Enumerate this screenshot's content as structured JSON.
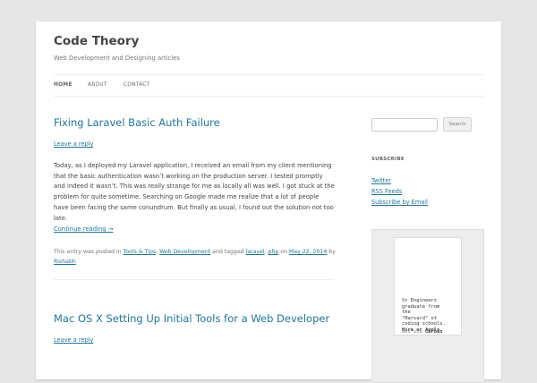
{
  "site": {
    "title": "Code Theory",
    "description": "Web Development and Designing articles"
  },
  "nav": {
    "items": [
      {
        "label": "HOME",
        "active": true
      },
      {
        "label": "ABOUT",
        "active": false
      },
      {
        "label": "CONTACT",
        "active": false
      }
    ]
  },
  "posts": [
    {
      "title": "Fixing Laravel Basic Auth Failure",
      "reply": "Leave a reply",
      "body": "Today, as I deployed my Laravel application, I received an email from my client mentioning that the basic authentication wasn’t working on the production server. I tested promptly and indeed it wasn’t. This was really strange for me as locally all was well. I got stuck at the problem for quite sometime. Searching on Google made me realize that a lot of people have been facing the same conundrum. But finally as usual, I found out the solution not too late.",
      "continue": "Continue reading →",
      "meta": {
        "prefix": "This entry was posted in",
        "cat1": "Tools & Tips",
        "comma": ",",
        "cat2": "Web Development",
        "tagged": "and tagged",
        "tag1": "laravel",
        "tag2": "php",
        "on": "on",
        "date": "May 22, 2014",
        "by": "by",
        "author": "Rishabh"
      }
    },
    {
      "title": "Mac OS X Setting Up Initial Tools for a Web Developer",
      "reply": "Leave a reply"
    }
  ],
  "sidebar": {
    "search": {
      "placeholder": "",
      "button": "Search"
    },
    "subscribe": {
      "heading": "SUBSCRIBE",
      "links": [
        "Twitter",
        "RSS Feeds",
        "Subscribe by Email"
      ]
    },
    "ad": {
      "line1": "Sr Engineers",
      "line2": "graduate from",
      "line3": "the",
      "line4": "\"Harvard\" of",
      "line5": "coding schools.",
      "cta": "Hire or Apply",
      "cta_end": ".",
      "via_prefix": "ads via",
      "via_brand": "Carbon"
    }
  },
  "colors": {
    "link": "#21759b",
    "background": "#e6e6e6",
    "page": "#ffffff"
  }
}
